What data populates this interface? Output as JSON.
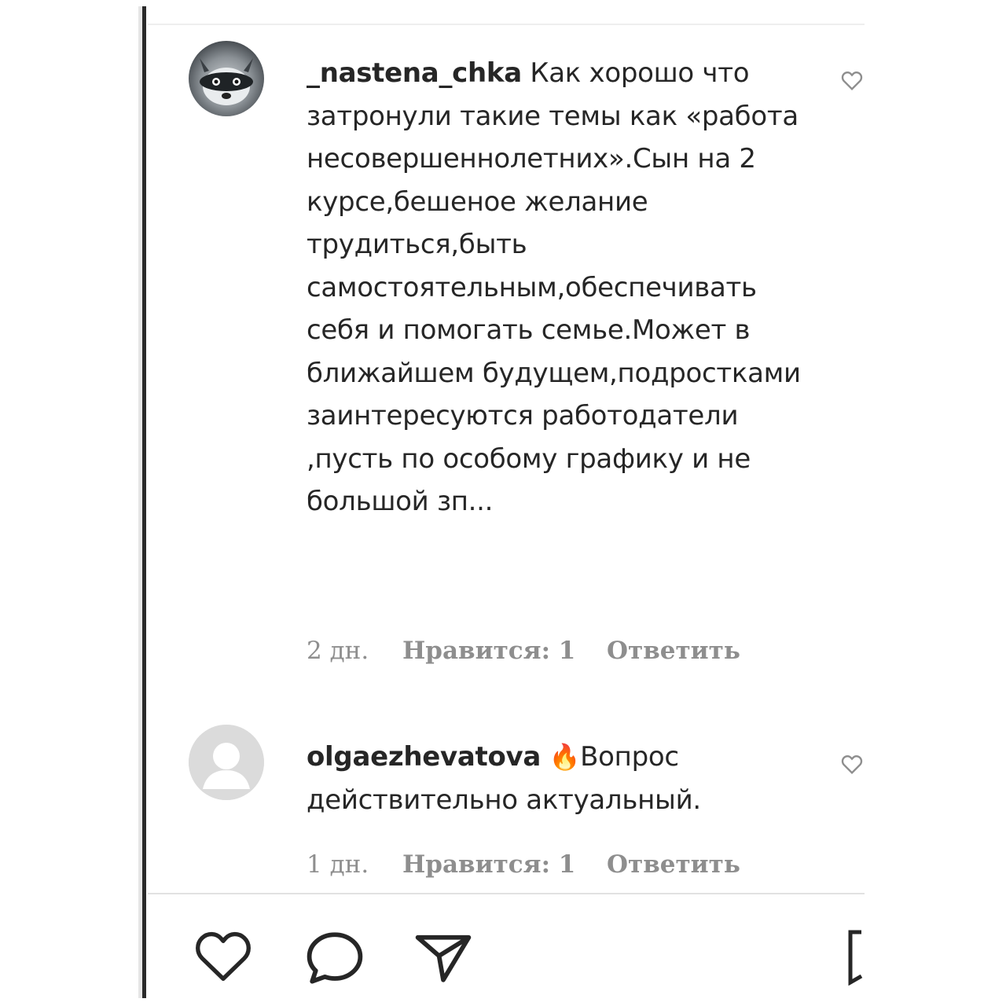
{
  "comments": [
    {
      "username": "_nastena_chka",
      "text": " Как хорошо что затронули такие темы как «работа несовершеннолетних».Сын на 2 курсе,бешеное желание трудиться,быть самостоятельным,обеспечивать себя и помогать семье.Может в ближайшем будущем,подростками заинтересуются работодатели ,пусть по особому графику и не большой зп...",
      "time": "2 дн.",
      "likes": "Нравится: 1",
      "reply": "Ответить",
      "avatar": "raccoon-avatar"
    },
    {
      "username": "olgaezhevatova",
      "emoji": "🔥",
      "text": "Вопрос действительно актуальный.",
      "time": "1 дн.",
      "likes": "Нравится: 1",
      "reply": "Ответить",
      "avatar": "default-avatar"
    }
  ],
  "actions": {
    "like_icon": "heart-icon",
    "comment_icon": "comment-bubble-icon",
    "share_icon": "paper-plane-icon",
    "save_icon": "bookmark-icon"
  },
  "colors": {
    "text": "#262626",
    "meta": "#8e8e8e",
    "emoji_fire": "#f29b2b"
  }
}
